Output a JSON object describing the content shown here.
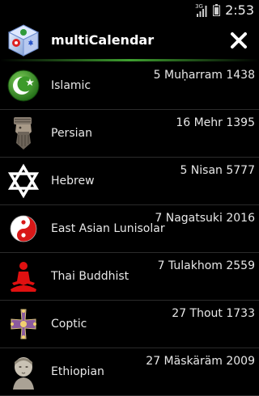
{
  "status_bar": {
    "network_type": "3G",
    "time": "2:53",
    "icons": [
      "signal-icon",
      "battery-icon"
    ]
  },
  "action_bar": {
    "title": "multiCalendar",
    "app_icon": "multicalendar-logo-icon",
    "close_icon": "close-icon",
    "accent_color": "#3fa030"
  },
  "calendars": [
    {
      "name": "Islamic",
      "date": "5 Muḥarram 1438",
      "icon": "crescent-star-icon"
    },
    {
      "name": "Persian",
      "date": "16 Mehr 1395",
      "icon": "persian-relief-icon"
    },
    {
      "name": "Hebrew",
      "date": "5 Nisan 5777",
      "icon": "star-of-david-icon"
    },
    {
      "name": "East Asian Lunisolar",
      "date": "7 Nagatsuki 2016",
      "icon": "yin-yang-icon"
    },
    {
      "name": "Thai Buddhist",
      "date": "7 Tulakhom 2559",
      "icon": "meditation-icon"
    },
    {
      "name": "Coptic",
      "date": "27 Thout 1733",
      "icon": "coptic-cross-icon"
    },
    {
      "name": "Ethiopian",
      "date": "27 Mäskäräm 2009",
      "icon": "ethiopian-bust-icon"
    }
  ]
}
